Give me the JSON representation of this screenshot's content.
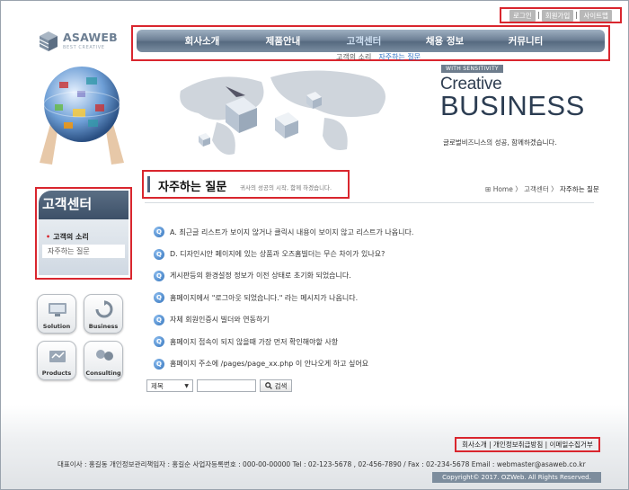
{
  "top_links": [
    "로그인",
    "회원가입",
    "사이트맵"
  ],
  "logo": {
    "name": "ASAWEB",
    "sub": "BEST CREATIVE"
  },
  "nav": {
    "items": [
      "회사소개",
      "제품안내",
      "고객센터",
      "채용 정보",
      "커뮤니티"
    ],
    "active_index": 2,
    "sub_items": [
      "고객의 소리",
      "자주하는 질문"
    ]
  },
  "banner": {
    "tag": "WITH SENSITIVITY",
    "creative": "Creative",
    "business": "BUSINESS",
    "slogan": "글로벌비즈니스의 성공, 함께하겠습니다."
  },
  "sidebar": {
    "title": "고객센터",
    "items": [
      "고객의 소리",
      "자주하는 질문"
    ]
  },
  "quick_links": [
    "Solution",
    "Business",
    "Products",
    "Consulting"
  ],
  "page": {
    "title": "자주하는 질문",
    "subtitle": "귀사의 성공의 시작, 함께 하겠습니다.",
    "breadcrumb": {
      "home": "Home",
      "sep": " 〉",
      "section": "고객센터",
      "current": "자주하는 질문"
    }
  },
  "faq": [
    "A. 최근글 리스트가 보이지 않거나 클릭시 내용이 보이지 않고 리스트가 나옵니다.",
    "D. 디자인시안 페이지에 있는 상품과 오즈홈빌더는 무슨 차이가 있나요?",
    "게시판등의 환경설정 정보가 이전 상태로 초기화 되었습니다.",
    "홈페이지에서 \"로그아웃 되었습니다.\" 라는 메시지가 나옵니다.",
    "자체 회원인증시 빌더와 연동하기",
    "홈페이지 접속이 되지 않을때 가장 먼저 확인해야할 사항",
    "홈페이지 주소에 /pages/page_xx.php 이 안나오게 하고 싶어요"
  ],
  "q_label": "Q",
  "search": {
    "select_value": "제목",
    "button_label": "검색"
  },
  "footer": {
    "links": "회사소개 | 개인정보취급방침 | 이메일수집거부",
    "info": "대표이사 : 홍길동   개인정보관리책임자 : 홍길순   사업자등록번호 : 000-00-00000 Tel : 02-123-5678 , 02-456-7890   /   Fax : 02-234-5678  Email : webmaster@asaweb.co.kr",
    "copyright": "Copyright© 2017. OZWeb. All Rights Reserved."
  }
}
